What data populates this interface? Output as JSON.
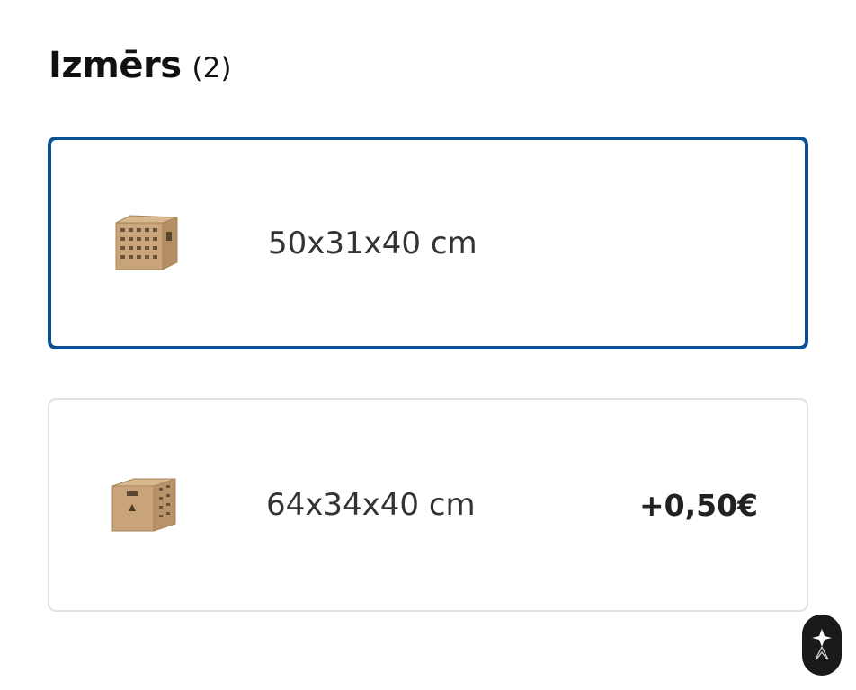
{
  "section": {
    "title": "Izmērs",
    "count": "(2)"
  },
  "options": [
    {
      "size": "50x31x40 cm",
      "price": "",
      "selected": true,
      "thumbnail_icon": "cardboard-box-icon"
    },
    {
      "size": "64x34x40 cm",
      "price": "+0,50€",
      "selected": false,
      "thumbnail_icon": "cardboard-box-icon"
    }
  ],
  "colors": {
    "selected_border": "#0b4f94",
    "unselected_border": "#e1e1e1",
    "box_cardboard": "#c9a47a"
  },
  "floating_button": {
    "icon": "assistant-logo-icon"
  }
}
